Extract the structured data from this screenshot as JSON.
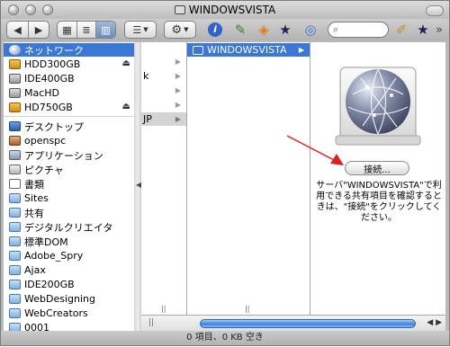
{
  "window": {
    "title": "WINDOWSVISTA",
    "status": "0 項目、0 KB 空き"
  },
  "toolbar": {
    "back_icon": "left-arrow",
    "forward_icon": "right-arrow",
    "view_icons": [
      "icon-view",
      "list-view",
      "column-view"
    ],
    "arrange_icon": "arrange-menu",
    "action_icon": "gear-menu",
    "info_icon": "info",
    "search_placeholder": "",
    "more_label": "»"
  },
  "sidebar": {
    "items": [
      {
        "label": "ネットワーク",
        "icon": "network",
        "selected": true
      },
      {
        "label": "HDD300GB",
        "icon": "drive",
        "eject": true
      },
      {
        "label": "IDE400GB",
        "icon": "drive"
      },
      {
        "label": "MacHD",
        "icon": "drive"
      },
      {
        "label": "HD750GB",
        "icon": "drive",
        "eject": true
      },
      {
        "label": "デスクトップ",
        "icon": "desktop"
      },
      {
        "label": "openspc",
        "icon": "home"
      },
      {
        "label": "アプリケーション",
        "icon": "applications"
      },
      {
        "label": "ピクチャ",
        "icon": "pictures"
      },
      {
        "label": "書類",
        "icon": "documents"
      },
      {
        "label": "Sites",
        "icon": "folder"
      },
      {
        "label": "共有",
        "icon": "folder"
      },
      {
        "label": "デジタルクリエイタ",
        "icon": "folder"
      },
      {
        "label": "標準DOM",
        "icon": "folder"
      },
      {
        "label": "Adobe_Spry",
        "icon": "folder"
      },
      {
        "label": "Ajax",
        "icon": "folder"
      },
      {
        "label": "IDE200GB",
        "icon": "folder"
      },
      {
        "label": "WebDesigning",
        "icon": "folder"
      },
      {
        "label": "WebCreators",
        "icon": "folder"
      },
      {
        "label": "0001",
        "icon": "folder"
      }
    ]
  },
  "columns": {
    "first_visible_labels": [
      "k",
      "JP"
    ],
    "selected_item": "WINDOWSVISTA"
  },
  "preview": {
    "connect_label": "接続...",
    "note": "サーバ\"WINDOWSVISTA\"で利用できる共有項目を確認するときは、\"接続\"をクリックしてください。"
  },
  "colors": {
    "selection": "#3b78d6",
    "annotation_arrow": "#e02020",
    "scroll_thumb": "#3b82e0"
  }
}
